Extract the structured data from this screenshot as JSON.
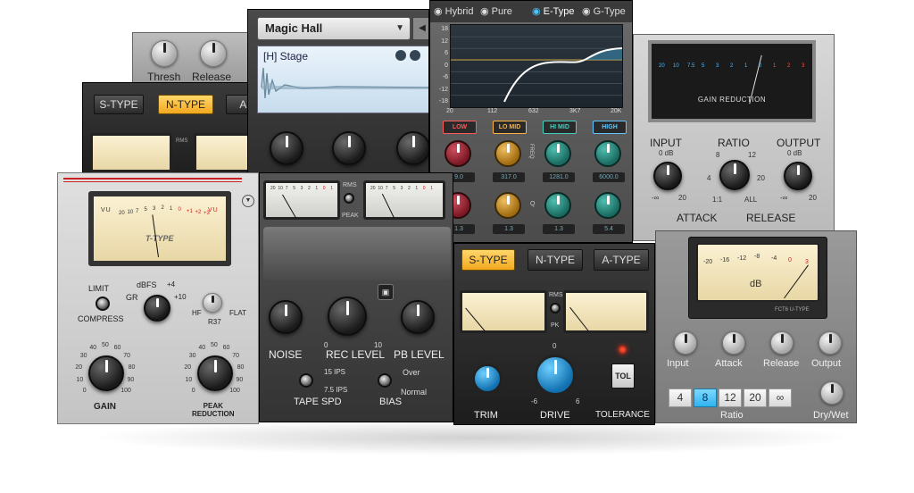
{
  "plugins": {
    "compressor_top": {
      "thresh_label": "Thresh",
      "release_label": "Release"
    },
    "type_selector_back": {
      "s_type": "S-TYPE",
      "n_type": "N-TYPE",
      "a_type": "A-T"
    },
    "reverb": {
      "preset": "Magic Hall",
      "patch": "[H] Stage"
    },
    "eq": {
      "modes": [
        "Hybrid",
        "Pure",
        "E-Type",
        "G-Type"
      ],
      "active_mode": "E-Type",
      "y_ticks": [
        "18",
        "12",
        "6",
        "0",
        "-6",
        "-12",
        "-18"
      ],
      "x_ticks": [
        "20",
        "112",
        "632",
        "3K7",
        "20K"
      ],
      "bands": [
        {
          "name": "LOW",
          "value": "9.0",
          "q": "1.3",
          "color": "#ff5a5a"
        },
        {
          "name": "LO MID",
          "value": "317.0",
          "q": "1.3",
          "color": "#ffb340"
        },
        {
          "name": "HI MID",
          "value": "1281.0",
          "q": "1.3",
          "color": "#40d0c0"
        },
        {
          "name": "HIGH",
          "value": "6000.0",
          "q": "5.4",
          "color": "#60c8ff"
        }
      ],
      "freq_label": "FREQ",
      "q_label": "Q"
    },
    "vca_comp": {
      "title": "GAIN REDUCTION",
      "scale": [
        "20",
        "10",
        "7.5",
        "5",
        "3",
        "2",
        "1",
        "0",
        "1",
        "2",
        "3"
      ],
      "input_label": "INPUT",
      "input_ticks": {
        "top": "0 dB",
        "left": "-∞",
        "right": "20"
      },
      "ratio_label": "RATIO",
      "ratio_ticks": {
        "tl": "8",
        "tr": "12",
        "l": "4",
        "r": "20",
        "bl": "1:1",
        "br": "ALL"
      },
      "output_label": "OUTPUT",
      "output_ticks": {
        "top": "0 dB",
        "left": "-∞",
        "right": "20"
      },
      "attack_label": "ATTACK",
      "release_label": "RELEASE"
    },
    "opto": {
      "meter_brand": "T-TYPE",
      "meter_vu": "VU",
      "meter_scale": [
        "20",
        "10",
        "7",
        "5",
        "3",
        "2",
        "1",
        "0",
        "+1",
        "+2",
        "+3"
      ],
      "limit_label": "LIMIT",
      "compress_label": "COMPRESS",
      "dbfs_label": "dBFS",
      "plus4_label": "+4",
      "gr_label": "GR",
      "plus10_label": "+10",
      "hf_label": "HF",
      "flat_label": "FLAT",
      "r37_label": "R37",
      "gain_label": "GAIN",
      "peak_label": "PEAK\nREDUCTION",
      "gain_ticks": [
        "0",
        "10",
        "20",
        "30",
        "40",
        "50",
        "60",
        "70",
        "80",
        "90",
        "100"
      ]
    },
    "tape": {
      "meter_scale": [
        "20",
        "10",
        "7",
        "5",
        "3",
        "2",
        "1",
        "0",
        "1"
      ],
      "rms_label": "RMS",
      "peak_label": "PEAK",
      "noise_label": "NOISE",
      "rec_level_label": "REC LEVEL",
      "rec_zero": "0",
      "rec_ten": "10",
      "pb_level_label": "PB LEVEL",
      "speed_15": "15 IPS",
      "speed_75": "7.5 IPS",
      "tape_spd_label": "TAPE SPD",
      "bias_over": "Over",
      "bias_normal": "Normal",
      "bias_label": "BIAS"
    },
    "bus_comp": {
      "types": [
        "S-TYPE",
        "N-TYPE",
        "A-TYPE"
      ],
      "active_type": "S-TYPE",
      "rms_label": "RMS",
      "pk_label": "PK",
      "trim_label": "TRIM",
      "drive_label": "DRIVE",
      "drive_ticks": {
        "top": "0",
        "left": "-6",
        "right": "6"
      },
      "tolerance_label": "TOLERANCE",
      "tol_button": "TOL"
    },
    "fet": {
      "meter_scale": [
        "-20",
        "-16",
        "-12",
        "-8",
        "-4",
        "0",
        "3"
      ],
      "meter_unit": "dB",
      "brand": "FCT6 U-TYPE",
      "knobs": [
        "Input",
        "Attack",
        "Release",
        "Output"
      ],
      "ratios": [
        "4",
        "8",
        "12",
        "20",
        "∞"
      ],
      "selected_ratio": "8",
      "ratio_label": "Ratio",
      "drywet_label": "Dry/Wet"
    }
  }
}
